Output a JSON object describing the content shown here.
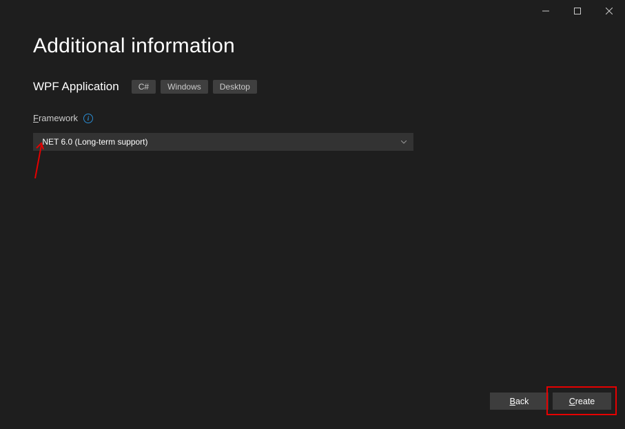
{
  "titlebar": {
    "minimize": "Minimize",
    "maximize": "Maximize",
    "close": "Close"
  },
  "page_title": "Additional information",
  "template": {
    "name": "WPF Application",
    "tags": [
      "C#",
      "Windows",
      "Desktop"
    ]
  },
  "framework": {
    "label_prefix": "F",
    "label_rest": "ramework",
    "info_tooltip": "i",
    "selected": ".NET 6.0 (Long-term support)"
  },
  "footer": {
    "back_prefix": "B",
    "back_rest": "ack",
    "create_prefix": "C",
    "create_rest": "reate"
  }
}
